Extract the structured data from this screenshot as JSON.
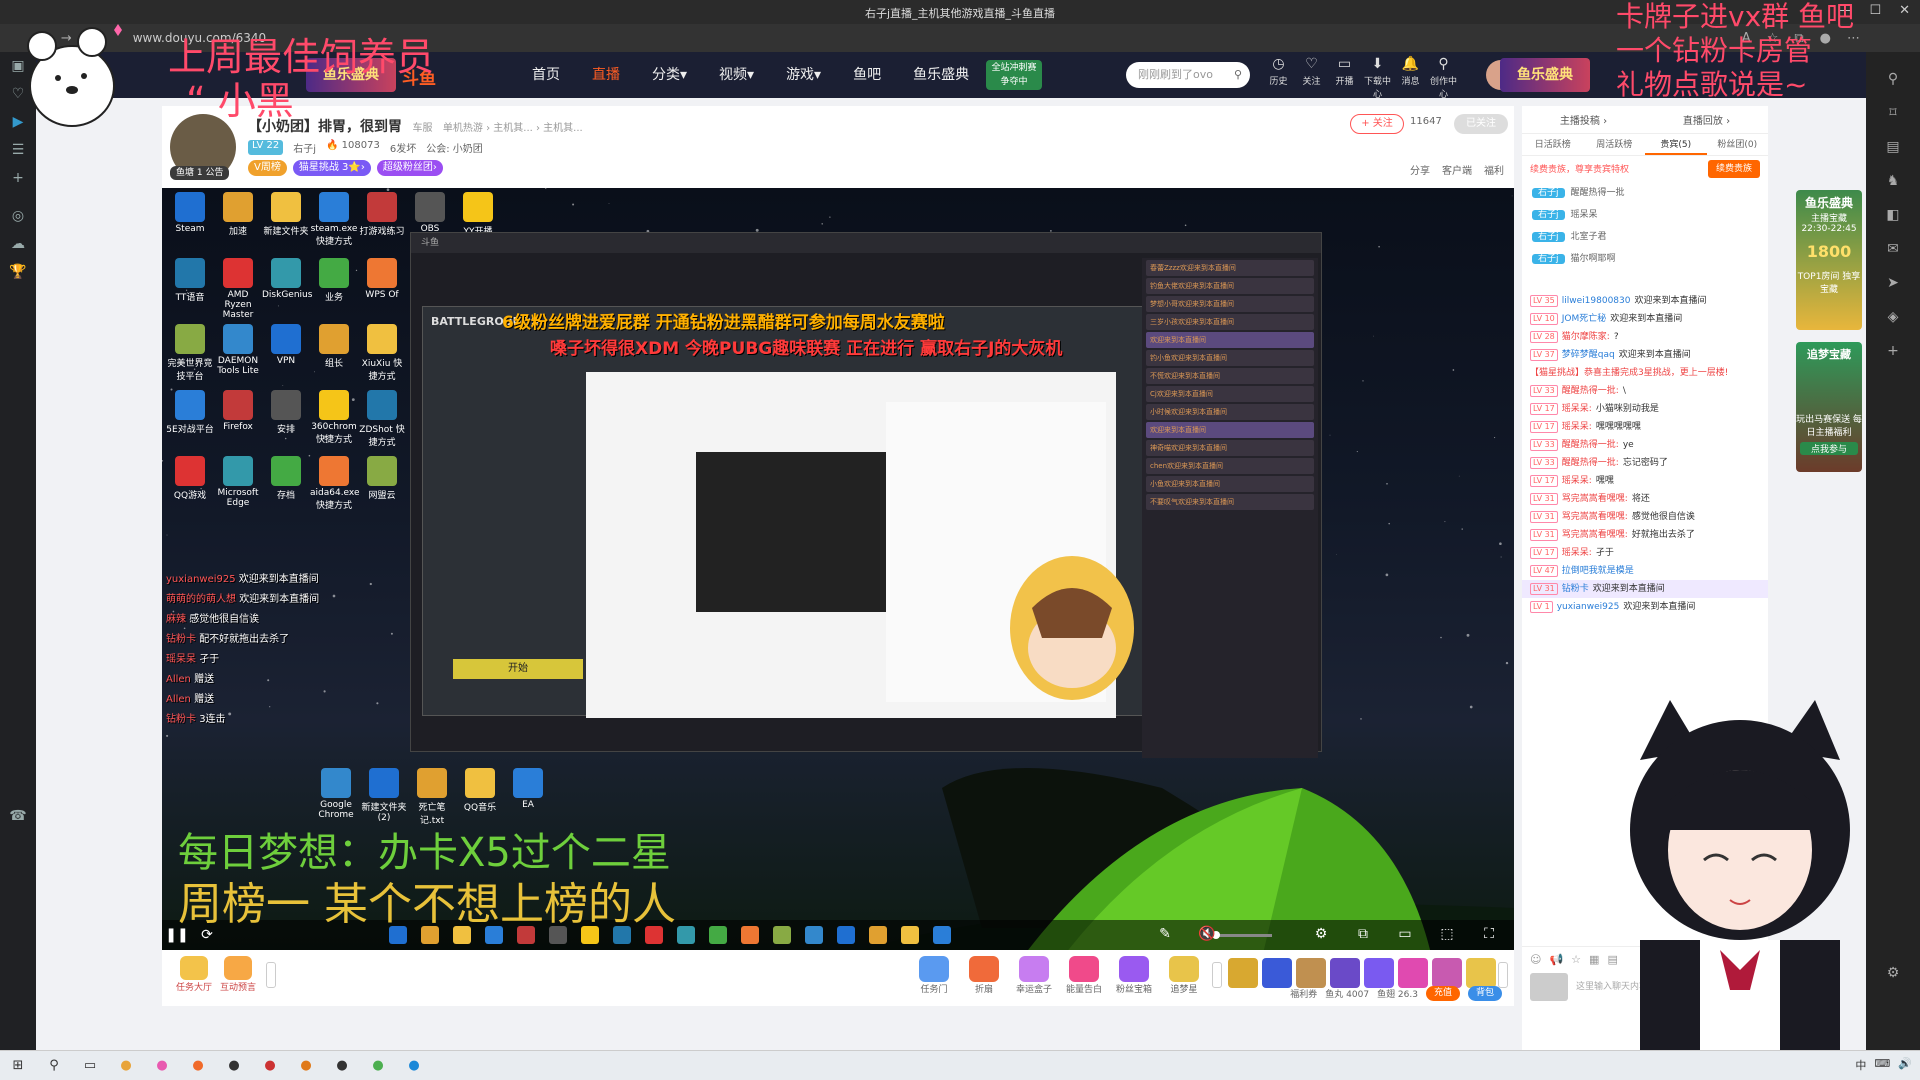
{
  "browser": {
    "tab_title": "右子j直播_主机其他游戏直播_斗鱼直播",
    "url": "www.douyu.com/6340",
    "window_controls": [
      "—",
      "☐",
      "✕"
    ]
  },
  "overlays": {
    "top_left_line1": "上周最佳饲养员",
    "top_left_line2": "“ 小黑",
    "top_right_line1": "卡牌子进vx群 鱼吧",
    "top_right_line2": "一个钻粉卡房管",
    "top_right_line3": "礼物点歌说是~",
    "bottom_line1": "每日梦想：办卡X5过个二星",
    "bottom_line2": "周榜一 某个不想上榜的人"
  },
  "site_nav": {
    "logo": "斗鱼",
    "event_logo": "鱼乐盛典",
    "menu": [
      {
        "label": "首页",
        "active": false
      },
      {
        "label": "直播",
        "active": true
      },
      {
        "label": "分类▾",
        "active": false
      },
      {
        "label": "视频▾",
        "active": false
      },
      {
        "label": "游戏▾",
        "active": false
      },
      {
        "label": "鱼吧",
        "active": false
      },
      {
        "label": "鱼乐盛典",
        "active": false
      }
    ],
    "promo": "全站冲刺赛 争夺中",
    "search_placeholder": "刚刚刷到了ovo",
    "tools": [
      {
        "icon": "◷",
        "label": "历史"
      },
      {
        "icon": "♡",
        "label": "关注"
      },
      {
        "icon": "▭",
        "label": "开播"
      },
      {
        "icon": "⬇",
        "label": "下载中心"
      },
      {
        "icon": "🔔",
        "label": "消息"
      },
      {
        "icon": "⚲",
        "label": "创作中心"
      }
    ]
  },
  "room": {
    "title": "【小奶团】排胃，很到胃",
    "category_prefix": "车服",
    "breadcrumb": "单机热游 › 主机其... › 主机其...",
    "level_badge": "LV 22",
    "host_name": "右子j",
    "hot": "108073",
    "fans": "6发坏",
    "announcement": "公会: 小奶团",
    "badges": [
      {
        "label": "V周榜",
        "color": "#f0a12c"
      },
      {
        "label": "猫星挑战 3⭐›",
        "color": "#7a5af5"
      },
      {
        "label": "超级粉丝团›",
        "color": "#9b4ef2"
      }
    ],
    "follow_label": "+ 关注",
    "follow_count": "11647",
    "followed_label": "已关注",
    "links": [
      "分享",
      "客户端",
      "福利"
    ],
    "avatar_tag": "鱼塘 1 公告"
  },
  "video": {
    "marquee1": "6级粉丝牌进爱屁群  开通钻粉进黑醋群可参加每周水友赛啦",
    "marquee2": "嗓子坏得很XDM  今晚PUBG趣味联赛  正在进行  赢取右子J的大灰机",
    "desktop_icons": [
      "Steam",
      "加速",
      "新建文件夹",
      "steam.exe 快捷方式",
      "打游戏练习",
      "OBS Studio",
      "YY开播",
      "TT语音",
      "AMD Ryzen Master",
      "DiskGenius",
      "业务",
      "WPS Of",
      "完美世界竞技平台",
      "DAEMON Tools Lite",
      "VPN",
      "组长",
      "XiuXiu 快捷方式",
      "5E对战平台",
      "Firefox",
      "安排",
      "360chrom 快捷方式",
      "ZDShot 快捷方式",
      "QQ游戏",
      "Microsoft Edge",
      "存档",
      "aida64.exe 快捷方式",
      "网盟云",
      "Google Chrome",
      "新建文件夹 (2)",
      "死亡笔记.txt",
      "QQ音乐",
      "EA"
    ],
    "overlay_chat": [
      {
        "name": "yuxianwei925",
        "text": "欢迎来到本直播间"
      },
      {
        "name": "萌萌的的萌人想",
        "text": "欢迎来到本直播间"
      },
      {
        "name": "麻辣",
        "text": "感觉他很自信诶"
      },
      {
        "name": "钻粉卡",
        "text": "配不好就拖出去杀了"
      },
      {
        "name": "瑶呆呆",
        "text": "孑于"
      },
      {
        "name": "Allen",
        "text": "赠送"
      },
      {
        "name": "Allen",
        "text": "赠送"
      },
      {
        "name": "钻粉卡",
        "text": "3连击"
      }
    ],
    "inner_chat": [
      "春蕾Zzzz欢迎来到本直播间",
      "钓鱼大佬欢迎来到本直播间",
      "梦想小哥欢迎来到本直播间",
      "三岁小孩欢迎来到本直播间",
      "欢迎来到本直播间",
      "钓小鱼欢迎来到本直播间",
      "不慌欢迎来到本直播间",
      "Cj欢迎来到本直播间",
      "小时候欢迎来到本直播间",
      "欢迎来到本直播间",
      "神奇喵欢迎来到本直播间",
      "chen欢迎来到本直播间",
      "小鱼欢迎来到本直播间",
      "不要叹气欢迎来到本直播间"
    ],
    "inner_game_title": "BATTLEGROUNDS",
    "inner_game_start": "开始",
    "controls": {
      "play": "❚❚",
      "refresh": "⟳"
    }
  },
  "giftbar": {
    "tasks": [
      {
        "label": "任务大厅"
      },
      {
        "label": "互动预言"
      }
    ],
    "gifts": [
      {
        "label": "任务门",
        "color": "#5a9af0"
      },
      {
        "label": "折扇",
        "color": "#f06a3a"
      },
      {
        "label": "幸运盒子",
        "color": "#c77df0"
      },
      {
        "label": "能量告白",
        "color": "#f04a8a"
      },
      {
        "label": "粉丝宝箱",
        "color": "#9a5af0"
      },
      {
        "label": "追梦星",
        "color": "#e8c44a"
      }
    ],
    "balance_fish_ball": "鱼丸 4007",
    "balance_fish_fin": "鱼翅 26.3",
    "recharge": "充值",
    "backpack": "背包",
    "welfare": "福利券"
  },
  "chat": {
    "top_links": [
      "主播投稿 ›",
      "直播回放 ›"
    ],
    "tabs": [
      {
        "label": "日活跃榜",
        "active": false
      },
      {
        "label": "周活跃榜",
        "active": false
      },
      {
        "label": "贵宾(5)",
        "active": true
      },
      {
        "label": "粉丝团(0)",
        "active": false
      }
    ],
    "vip_notice": "续费贵族，尊享贵宾特权",
    "vip_button": "续费贵族",
    "vip_list": [
      {
        "badge": "右子j",
        "name": "醒醒热得一批"
      },
      {
        "badge": "右子j",
        "name": "瑶呆呆"
      },
      {
        "badge": "右子j",
        "name": "北室子君"
      },
      {
        "badge": "右子j",
        "name": "猫尔啊耶啊"
      }
    ],
    "messages": [
      {
        "lv": "LV 35",
        "name": "lilwei19800830",
        "text": "欢迎来到本直播间",
        "type": "normal"
      },
      {
        "lv": "LV 10",
        "name": "JOM死亡秘",
        "text": "欢迎来到本直播间",
        "type": "normal"
      },
      {
        "lv": "LV 28",
        "name": "猫尔摩陈家:",
        "text": "?",
        "type": "normal"
      },
      {
        "lv": "LV 37",
        "name": "梦碎梦醒qaq",
        "text": "欢迎来到本直播间",
        "type": "normal"
      },
      {
        "lv": "",
        "name": "",
        "text": "【猫星挑战】恭喜主播完成3星挑战，更上一层楼!",
        "type": "sys"
      },
      {
        "lv": "LV 33",
        "name": "醒醒热得一批:",
        "text": "\\",
        "type": "normal"
      },
      {
        "lv": "LV 17",
        "name": "瑶呆呆:",
        "text": "小猫咪别动我是",
        "type": "normal"
      },
      {
        "lv": "LV 17",
        "name": "瑶呆呆:",
        "text": "嘿嘿嘿嘿嘿",
        "type": "normal"
      },
      {
        "lv": "LV 33",
        "name": "醒醒热得一批:",
        "text": "ye",
        "type": "normal"
      },
      {
        "lv": "LV 33",
        "name": "醒醒热得一批:",
        "text": "忘记密码了",
        "type": "normal"
      },
      {
        "lv": "LV 17",
        "name": "瑶呆呆:",
        "text": "嘿嘿",
        "type": "normal"
      },
      {
        "lv": "LV 31",
        "name": "骂完嵩嵩看嘿嘿:",
        "text": "将还",
        "type": "normal"
      },
      {
        "lv": "LV 31",
        "name": "骂完嵩嵩看嘿嘿:",
        "text": "感觉他很自信诶",
        "type": "normal"
      },
      {
        "lv": "LV 31",
        "name": "骂完嵩嵩看嘿嘿:",
        "text": "好就拖出去杀了",
        "type": "normal"
      },
      {
        "lv": "LV 17",
        "name": "瑶呆呆:",
        "text": "孑于",
        "type": "normal"
      },
      {
        "lv": "LV 47",
        "name": "拉倒吧我就是模是",
        "text": "",
        "type": "normal"
      },
      {
        "lv": "LV 31",
        "name": "钻粉卡",
        "text": "欢迎来到本直播间",
        "type": "hl"
      },
      {
        "lv": "LV 1",
        "name": "yuxianwei925",
        "text": "欢迎来到本直播间",
        "type": "normal"
      }
    ],
    "input_placeholder": "这里输入聊天内容"
  },
  "promo": {
    "box1_title": "鱼乐盛典",
    "box1_sub": "主播宝藏",
    "box1_time": "22:30-22:45",
    "box1_value": "1800",
    "box1_foot": "TOP1房间 独享宝藏",
    "box2_title": "追梦宝藏",
    "box2_foot": "玩出马赛保送 每日主播福利",
    "box2_btn": "点我参与"
  },
  "taskbar": {
    "tray": [
      "中",
      "⌨",
      "🔊"
    ]
  }
}
